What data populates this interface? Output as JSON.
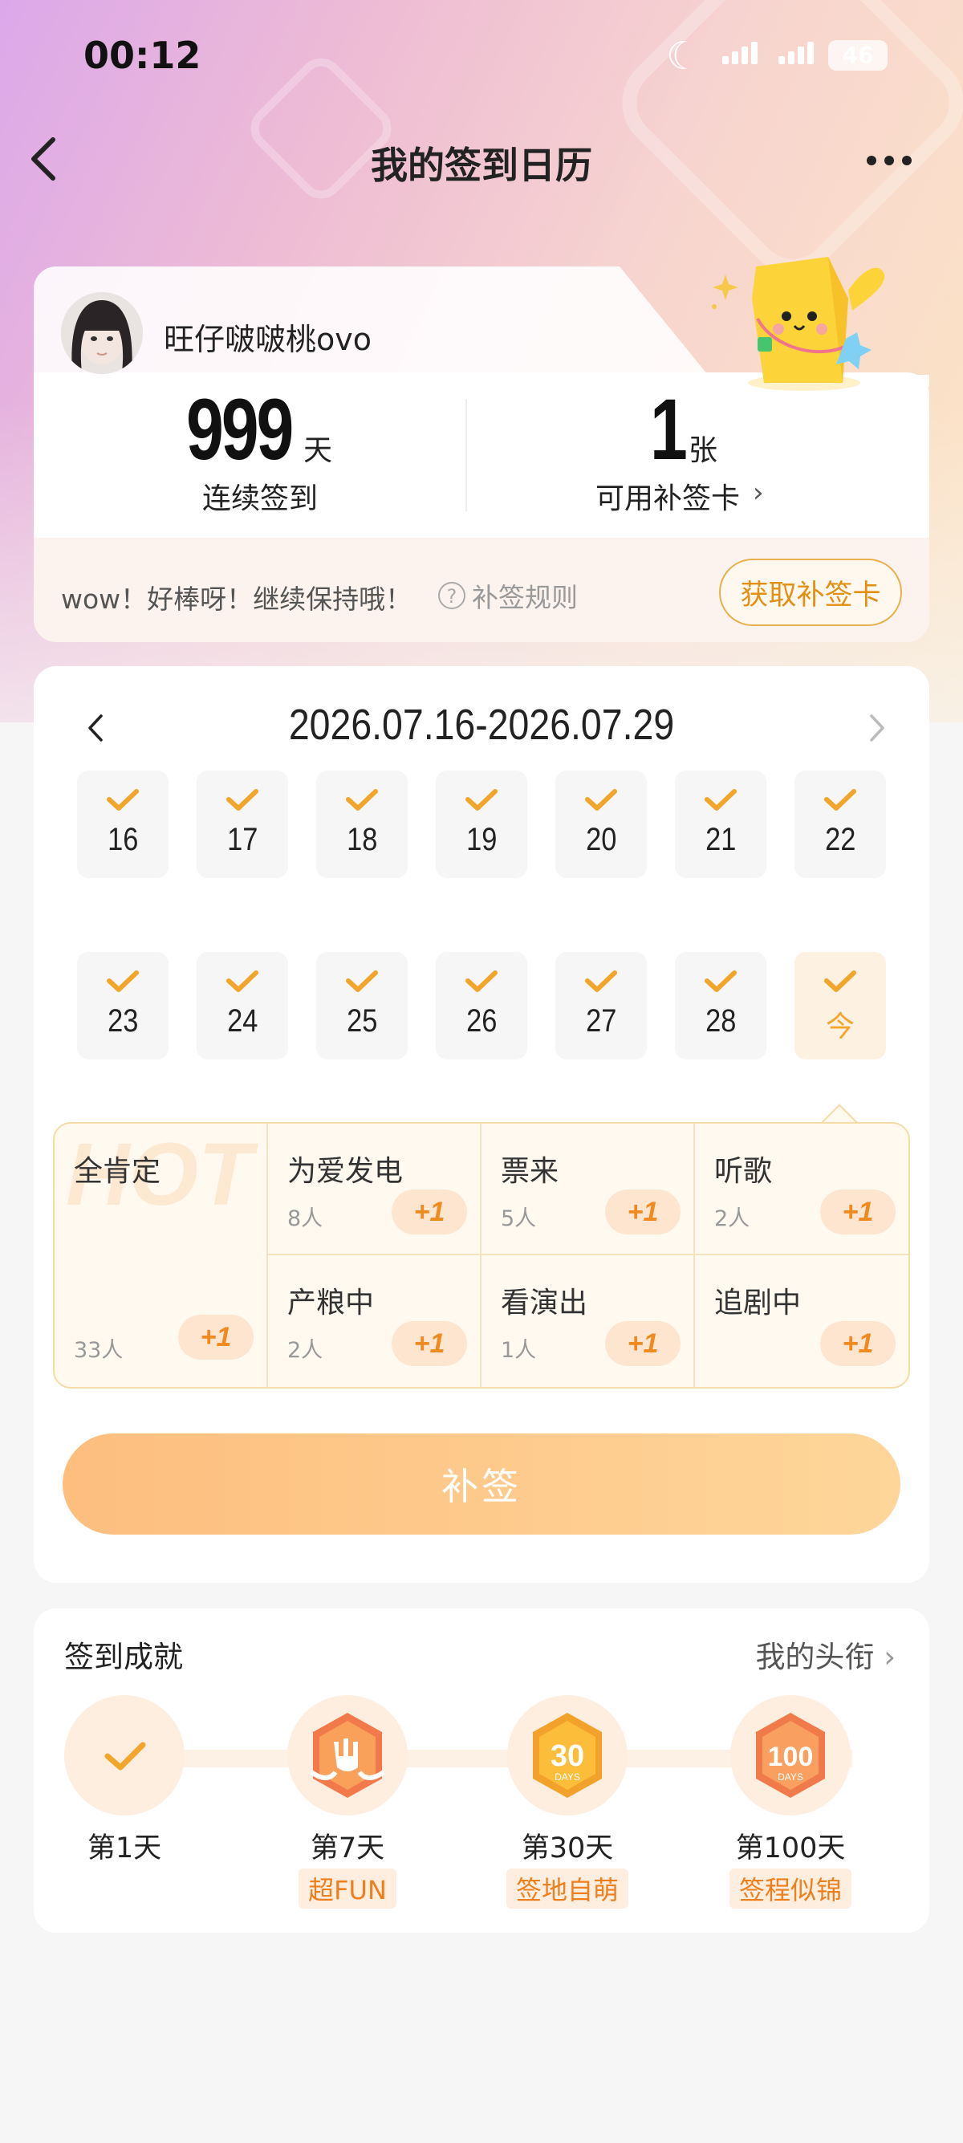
{
  "status_bar": {
    "time": "00:12",
    "battery": "46"
  },
  "nav": {
    "title": "我的签到日历"
  },
  "profile": {
    "username": "旺仔啵啵桃ovo",
    "streak_value": "999",
    "streak_unit": "天",
    "streak_label": "连续签到",
    "cards_value": "1",
    "cards_unit": "张",
    "cards_label": "可用补签卡",
    "message": "wow！好棒呀！继续保持哦！",
    "rules_label": "补签规则",
    "get_card_label": "获取补签卡"
  },
  "calendar": {
    "range": "2026.07.16-2026.07.29",
    "days": [
      {
        "label": "16",
        "checked": true
      },
      {
        "label": "17",
        "checked": true
      },
      {
        "label": "18",
        "checked": true
      },
      {
        "label": "19",
        "checked": true
      },
      {
        "label": "20",
        "checked": true
      },
      {
        "label": "21",
        "checked": true
      },
      {
        "label": "22",
        "checked": true
      },
      {
        "label": "23",
        "checked": true
      },
      {
        "label": "24",
        "checked": true
      },
      {
        "label": "25",
        "checked": true
      },
      {
        "label": "26",
        "checked": true
      },
      {
        "label": "27",
        "checked": true
      },
      {
        "label": "28",
        "checked": true
      },
      {
        "label": "今",
        "checked": true,
        "today": true
      }
    ]
  },
  "mood": {
    "hot": {
      "name": "全肯定",
      "count": "33人",
      "plus": "+1",
      "watermark": "HOT"
    },
    "items": [
      {
        "name": "为爱发电",
        "count": "8人",
        "plus": "+1"
      },
      {
        "name": "票来",
        "count": "5人",
        "plus": "+1"
      },
      {
        "name": "听歌",
        "count": "2人",
        "plus": "+1"
      },
      {
        "name": "产粮中",
        "count": "2人",
        "plus": "+1"
      },
      {
        "name": "看演出",
        "count": "1人",
        "plus": "+1"
      },
      {
        "name": "追剧中",
        "count": "",
        "plus": "+1"
      }
    ]
  },
  "resign_button": "补签",
  "achievements": {
    "title": "签到成就",
    "link": "我的头衔",
    "items": [
      {
        "label": "第1天",
        "tag": "",
        "icon": "check-icon"
      },
      {
        "label": "第7天",
        "tag": "超FUN",
        "icon": "rock-hand-badge-icon"
      },
      {
        "label": "第30天",
        "tag": "签地自萌",
        "icon": "30-days-badge-icon"
      },
      {
        "label": "第100天",
        "tag": "签程似锦",
        "icon": "100-days-badge-icon"
      }
    ]
  },
  "colors": {
    "accent": "#f2a52b",
    "plus_bg": "#fde5cf",
    "plus_text": "#ef8a1e"
  }
}
